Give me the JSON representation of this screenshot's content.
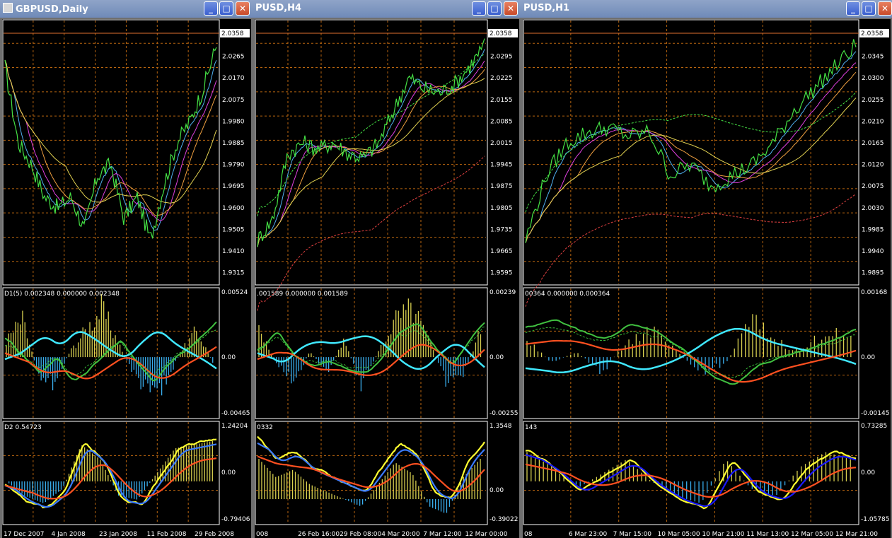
{
  "colors": {
    "grid": "#b8650f",
    "frame": "#ffffff",
    "bg": "#000000",
    "bull": "#d8d050",
    "bear": "#3ab0f0",
    "price": "#44e044",
    "ma1": "#50b0f0",
    "ma2": "#e040e0",
    "ma3": "#f0a040",
    "ma4": "#e0d050",
    "ma5": "#e04040",
    "cyan": "#40e8ff",
    "orange": "#ff5020",
    "green": "#40c040",
    "yellow": "#ffff30",
    "blue": "#3b7bff",
    "deepblue": "#1a1aff"
  },
  "icons": {
    "minimize": "minimize-icon",
    "maximize": "maximize-icon",
    "close": "close-icon",
    "app": "chart-window-icon"
  },
  "windows": [
    {
      "title": "GBPUSD,Daily",
      "minimize": "_",
      "maximize": "□",
      "close": "✕",
      "price_axis": [
        "2.0358",
        "2.0265",
        "2.0170",
        "2.0075",
        "1.9980",
        "1.9885",
        "1.9790",
        "1.9695",
        "1.9600",
        "1.9505",
        "1.9410",
        "1.9315"
      ],
      "price_tag": "2.0358",
      "ind1_label": "D1(5) 0.002348 0.000000 0.002348",
      "ind1_axis": [
        "0.00524",
        "0.00",
        "-0.00465"
      ],
      "ind2_label": "D2 0.54723",
      "ind2_axis": [
        "1.24204",
        "0.00",
        "-0.79406"
      ],
      "time_axis": [
        "17 Dec 2007",
        "4 Jan 2008",
        "23 Jan 2008",
        "11 Feb 2008",
        "29 Feb 2008"
      ]
    },
    {
      "title": "PUSD,H4",
      "minimize": "_",
      "maximize": "□",
      "close": "✕",
      "price_axis": [
        "2.0358",
        "2.0295",
        "2.0225",
        "2.0155",
        "2.0085",
        "2.0015",
        "1.9945",
        "1.9875",
        "1.9805",
        "1.9735",
        "1.9665",
        "1.9595"
      ],
      "price_tag": "2.0358",
      "ind1_label": ".001589 0.000000 0.001589",
      "ind1_axis": [
        "0.00239",
        "0.00",
        "-0.00255"
      ],
      "ind2_label": "0332",
      "ind2_axis": [
        "1.3548",
        "0.00",
        "-0.39022"
      ],
      "time_axis": [
        "008",
        "26 Feb 16:00",
        "29 Feb 08:00",
        "4 Mar 20:00",
        "7 Mar 12:00",
        "12 Mar 00:00"
      ]
    },
    {
      "title": "PUSD,H1",
      "minimize": "_",
      "maximize": "□",
      "close": "✕",
      "price_axis": [
        "2.0358",
        "2.0345",
        "2.0300",
        "2.0255",
        "2.0210",
        "2.0165",
        "2.0120",
        "2.0075",
        "2.0030",
        "1.9985",
        "1.9940",
        "1.9895"
      ],
      "price_tag": "2.0358",
      "ind1_label": "00364 0.000000 0.000364",
      "ind1_axis": [
        "0.00168",
        "0.00",
        "-0.00145"
      ],
      "ind2_label": "143",
      "ind2_axis": [
        "0.73285",
        "0.00",
        "-1.05785"
      ],
      "time_axis": [
        "08",
        "6 Mar 23:00",
        "7 Mar 15:00",
        "10 Mar 05:00",
        "10 Mar 21:00",
        "11 Mar 13:00",
        "12 Mar 05:00",
        "12 Mar 21:00"
      ]
    }
  ]
}
